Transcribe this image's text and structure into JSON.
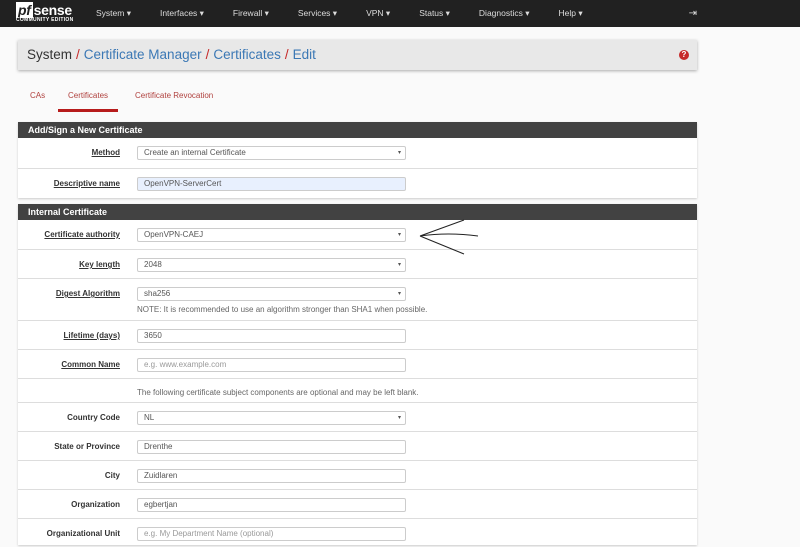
{
  "brand": {
    "name_pf": "pf",
    "name_rest": "sense",
    "edition": "COMMUNITY EDITION"
  },
  "menu": [
    "System ▾",
    "Interfaces ▾",
    "Firewall ▾",
    "Services ▾",
    "VPN ▾",
    "Status ▾",
    "Diagnostics ▾",
    "Help ▾"
  ],
  "breadcrumb": {
    "root": "System",
    "items": [
      "Certificate Manager",
      "Certificates",
      "Edit"
    ],
    "sep": "/"
  },
  "tabs": [
    "CAs",
    "Certificates",
    "Certificate Revocation"
  ],
  "active_tab": "Certificates",
  "section1": {
    "title": "Add/Sign a New Certificate",
    "method": {
      "label": "Method",
      "value": "Create an internal Certificate"
    },
    "descr": {
      "label": "Descriptive name",
      "value": "OpenVPN-ServerCert"
    }
  },
  "section2": {
    "title": "Internal Certificate",
    "ca": {
      "label": "Certificate authority",
      "value": "OpenVPN-CAEJ"
    },
    "keylen": {
      "label": "Key length",
      "value": "2048"
    },
    "digest": {
      "label": "Digest Algorithm",
      "value": "sha256",
      "note": "NOTE: It is recommended to use an algorithm stronger than SHA1 when possible."
    },
    "lifetime": {
      "label": "Lifetime (days)",
      "value": "3650"
    },
    "cn": {
      "label": "Common Name",
      "placeholder": "e.g. www.example.com"
    },
    "optional_note": "The following certificate subject components are optional and may be left blank.",
    "country": {
      "label": "Country Code",
      "value": "NL"
    },
    "state": {
      "label": "State or Province",
      "value": "Drenthe"
    },
    "city": {
      "label": "City",
      "value": "Zuidlaren"
    },
    "org": {
      "label": "Organization",
      "value": "egbertjan"
    },
    "ou": {
      "label": "Organizational Unit",
      "placeholder": "e.g. My Department Name (optional)"
    }
  },
  "icons": {
    "caret": "▾",
    "help": "?",
    "logout": "⇥"
  }
}
